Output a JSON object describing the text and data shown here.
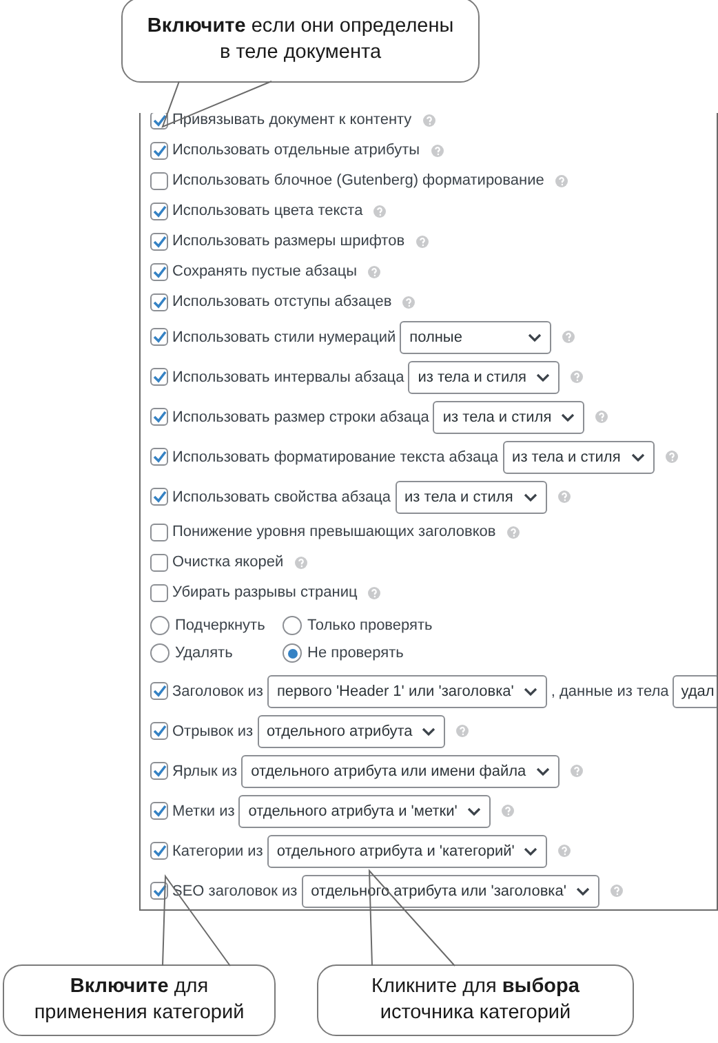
{
  "panel": {
    "rows": [
      {
        "kind": "checkbox",
        "label": "Привязывать документ к контенту",
        "checked": true,
        "help": true
      },
      {
        "kind": "checkbox",
        "label": "Использовать отдельные атрибуты",
        "checked": true,
        "help": true
      },
      {
        "kind": "checkbox",
        "label": "Использовать блочное (Gutenberg) форматирование",
        "checked": false,
        "help": true
      },
      {
        "kind": "checkbox",
        "label": "Использовать цвета текста",
        "checked": true,
        "help": true
      },
      {
        "kind": "checkbox",
        "label": "Использовать размеры шрифтов",
        "checked": true,
        "help": true
      },
      {
        "kind": "checkbox",
        "label": "Сохранять пустые абзацы",
        "checked": true,
        "help": true
      },
      {
        "kind": "checkbox",
        "label": "Использовать отступы абзацев",
        "checked": true,
        "help": true
      },
      {
        "kind": "select",
        "label": "Использовать стили нумераций",
        "checked": true,
        "value": "полные",
        "help": true
      },
      {
        "kind": "select",
        "label": "Использовать интервалы абзаца",
        "checked": true,
        "value": "из тела и стиля",
        "help": true
      },
      {
        "kind": "select",
        "label": "Использовать размер строки абзаца",
        "checked": true,
        "value": "из тела и стиля",
        "help": true
      },
      {
        "kind": "select",
        "label": "Использовать форматирование текста абзаца",
        "checked": true,
        "value": "из тела и стиля",
        "help": true
      },
      {
        "kind": "select",
        "label": "Использовать свойства абзаца",
        "checked": true,
        "value": "из тела и стиля",
        "help": true
      },
      {
        "kind": "checkbox",
        "label": "Понижение уровня превышающих заголовков",
        "checked": false,
        "help": true
      },
      {
        "kind": "checkbox",
        "label": "Очистка якорей",
        "checked": false,
        "help": true
      },
      {
        "kind": "checkbox",
        "label": "Убирать разрывы страниц",
        "checked": false,
        "help": true
      },
      {
        "kind": "radios",
        "options": [
          {
            "label": "Подчеркнуть",
            "selected": false
          },
          {
            "label": "Только проверять",
            "selected": false
          },
          {
            "label": "Удалять",
            "selected": false
          },
          {
            "label": "Не проверять",
            "selected": true
          }
        ]
      },
      {
        "kind": "select",
        "label": "Заголовок из",
        "checked": true,
        "value": "первого 'Header 1' или 'заголовка'",
        "after": ", данные из тела",
        "extra": "удал",
        "help": false
      },
      {
        "kind": "select",
        "label": "Отрывок из",
        "checked": true,
        "value": "отдельного атрибута",
        "help": true
      },
      {
        "kind": "select",
        "label": "Ярлык из",
        "checked": true,
        "value": "отдельного атрибута или имени файла",
        "help": true
      },
      {
        "kind": "select",
        "label": "Метки из",
        "checked": true,
        "value": "отдельного атрибута и 'метки'",
        "help": true
      },
      {
        "kind": "select",
        "label": "Категории из",
        "checked": true,
        "value": "отдельного атрибута и 'категорий'",
        "help": true
      },
      {
        "kind": "select",
        "label": "SEO заголовок из",
        "checked": true,
        "value": "отдельного атрибута или 'заголовка'",
        "help": true
      }
    ]
  },
  "callouts": [
    {
      "lines": [
        "**Включите** если они определены",
        "в теле документа"
      ]
    },
    {
      "lines": [
        "**Включите** для",
        "применения категорий"
      ]
    },
    {
      "lines": [
        "Кликните для **выбора**",
        "источника категорий"
      ]
    }
  ]
}
